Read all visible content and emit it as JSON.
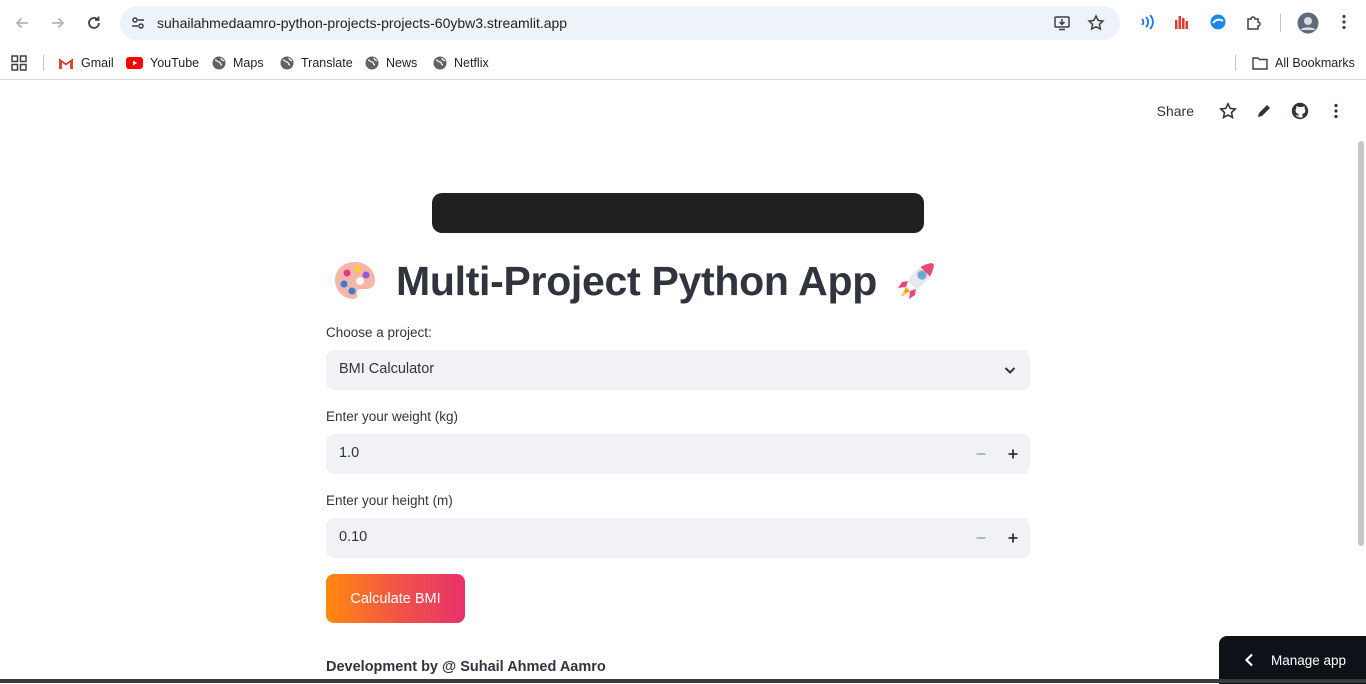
{
  "browser": {
    "url": "suhailahmedaamro-python-projects-projects-60ybw3.streamlit.app",
    "bookmarks": [
      {
        "label": "Gmail",
        "icon": "gmail-icon"
      },
      {
        "label": "YouTube",
        "icon": "youtube-icon"
      },
      {
        "label": "Maps",
        "icon": "globe-icon"
      },
      {
        "label": "Translate",
        "icon": "globe-icon"
      },
      {
        "label": "News",
        "icon": "globe-icon"
      },
      {
        "label": "Netflix",
        "icon": "globe-icon"
      }
    ],
    "all_bookmarks": "All Bookmarks"
  },
  "streamlit_header": {
    "share_label": "Share"
  },
  "app": {
    "title": "Multi-Project Python App",
    "title_emoji_left": "palette",
    "title_emoji_right": "rocket",
    "project_select": {
      "label": "Choose a project:",
      "value": "BMI Calculator"
    },
    "weight_input": {
      "label": "Enter your weight (kg)",
      "value": "1.0"
    },
    "height_input": {
      "label": "Enter your height (m)",
      "value": "0.10"
    },
    "calculate_button": "Calculate BMI",
    "footer": "Development by @ Suhail Ahmed Aamro",
    "manage_app": "Manage app"
  },
  "colors": {
    "accent_gradient_start": "#ff8a0f",
    "accent_gradient_end": "#e8326b",
    "input_bg": "#f0f2f6",
    "text": "#31333f",
    "banner": "#212121"
  }
}
